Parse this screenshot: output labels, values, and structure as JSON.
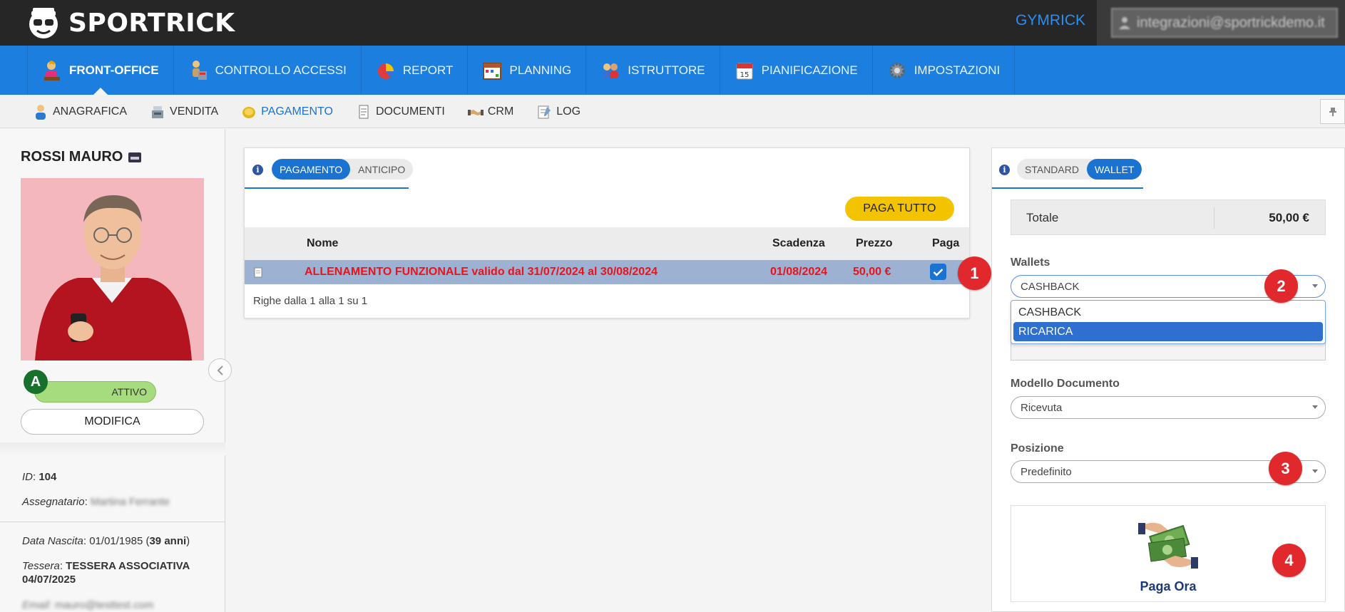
{
  "header": {
    "brand": "SPORTRICK",
    "gym_name": "GYMRICK",
    "user_email": "integrazioni@sportrickdemo.it"
  },
  "main_nav": [
    {
      "label": "FRONT-OFFICE",
      "icon": "user-desk-icon",
      "active": true
    },
    {
      "label": "CONTROLLO ACCESSI",
      "icon": "turnstile-icon",
      "active": false
    },
    {
      "label": "REPORT",
      "icon": "pie-chart-icon",
      "active": false
    },
    {
      "label": "PLANNING",
      "icon": "calendar-grid-icon",
      "active": false
    },
    {
      "label": "ISTRUTTORE",
      "icon": "users-icon",
      "active": false
    },
    {
      "label": "PIANIFICAZIONE",
      "icon": "calendar-icon",
      "active": false
    },
    {
      "label": "IMPOSTAZIONI",
      "icon": "gear-icon",
      "active": false
    }
  ],
  "sub_nav": [
    {
      "label": "ANAGRAFICA",
      "icon": "person-icon",
      "active": false
    },
    {
      "label": "VENDITA",
      "icon": "cash-register-icon",
      "active": false
    },
    {
      "label": "PAGAMENTO",
      "icon": "coin-icon",
      "active": true
    },
    {
      "label": "DOCUMENTI",
      "icon": "document-icon",
      "active": false
    },
    {
      "label": "CRM",
      "icon": "handshake-icon",
      "active": false
    },
    {
      "label": "LOG",
      "icon": "log-icon",
      "active": false
    }
  ],
  "customer": {
    "name": "ROSSI MAURO",
    "badge_letter": "A",
    "status": "ATTIVO",
    "modify_label": "MODIFICA",
    "id_label": "ID",
    "id_value": "104",
    "assignee_label": "Assegnatario",
    "assignee_value": "Martina Ferrante",
    "birth_label": "Data Nascita",
    "birth_value": "01/01/1985",
    "age": "39 anni",
    "card_label": "Tessera",
    "card_value": "TESSERA ASSOCIATIVA",
    "card_date": "04/07/2025",
    "email_label": "Email",
    "email_value": "mauro@testtest.com"
  },
  "payment": {
    "tabs": [
      "PAGAMENTO",
      "ANTICIPO"
    ],
    "pay_all": "PAGA TUTTO",
    "columns": {
      "name": "Nome",
      "due": "Scadenza",
      "price": "Prezzo",
      "pay": "Paga"
    },
    "rows": [
      {
        "name": "ALLENAMENTO FUNZIONALE valido dal 31/07/2024 al 30/08/2024",
        "due": "01/08/2024",
        "price": "50,00 €",
        "checked": true
      }
    ],
    "footer": "Righe dalla 1 alla 1 su 1"
  },
  "wallet": {
    "tabs": [
      "STANDARD",
      "WALLET"
    ],
    "total_label": "Totale",
    "total_value": "50,00 €",
    "wallets_label": "Wallets",
    "wallets_selected": "CASHBACK",
    "wallet_options": [
      "CASHBACK",
      "RICARICA"
    ],
    "highlighted_option": "RICARICA",
    "doc_model_label": "Modello Documento",
    "doc_model_value": "Ricevuta",
    "position_label": "Posizione",
    "position_value": "Predefinito",
    "pay_now": "Paga Ora"
  },
  "markers": [
    "1",
    "2",
    "3",
    "4"
  ],
  "colors": {
    "nav_blue": "#1c7fe0",
    "accent_blue": "#1a73d1",
    "pay_all_yellow": "#f4c300",
    "row_highlight": "#9db1d3",
    "row_text_red": "#e8141b",
    "marker_red": "#e1282d",
    "status_green": "#a6dc7e"
  }
}
